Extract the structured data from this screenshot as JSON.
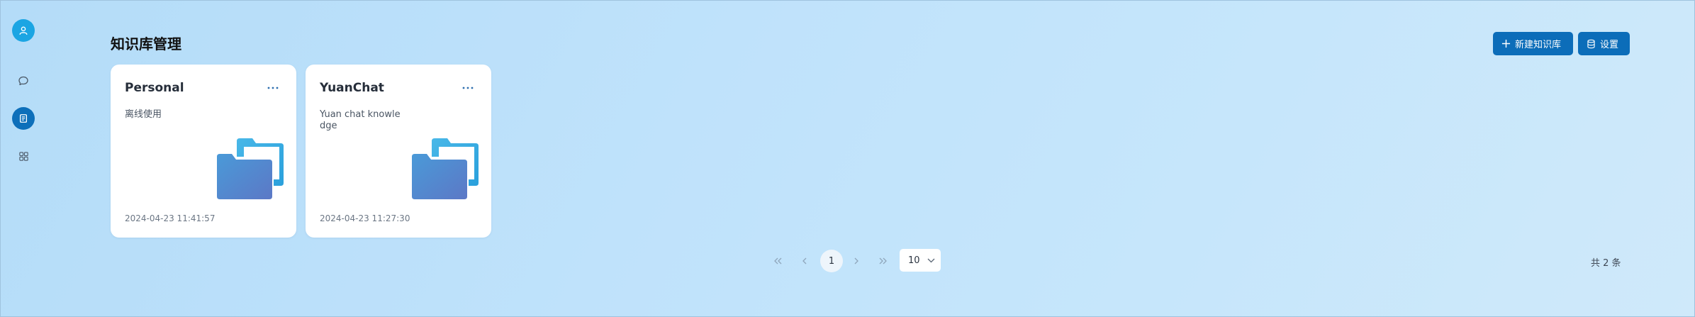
{
  "sidebar": {
    "items": [
      {
        "name": "user",
        "icon": "user-icon"
      },
      {
        "name": "chat",
        "icon": "chat-bubble-icon"
      },
      {
        "name": "knowledge-base",
        "icon": "book-icon",
        "active": true
      },
      {
        "name": "apps",
        "icon": "grid-icon"
      }
    ]
  },
  "header": {
    "title": "知识库管理",
    "new_button_label": "新建知识库",
    "settings_button_label": "设置"
  },
  "cards": [
    {
      "title": "Personal",
      "description": "离线使用",
      "time": "2024-04-23 11:41:57",
      "icon": "folder-icon"
    },
    {
      "title": "YuanChat",
      "description": "Yuan chat knowledge",
      "time": "2024-04-23 11:27:30",
      "icon": "folder-icon"
    }
  ],
  "pagination": {
    "current_page": "1",
    "page_size": "10",
    "total_text": "共 2 条"
  },
  "colors": {
    "accent": "#0c6db9",
    "avatar": "#1ba5e3",
    "background": "#bfe2fb"
  }
}
